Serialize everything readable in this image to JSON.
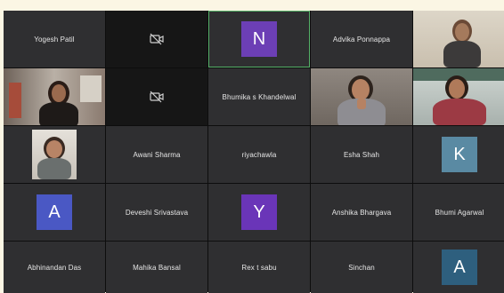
{
  "participants": [
    {
      "name": "Yogesh Patil"
    },
    {
      "name": ""
    },
    {
      "name": "",
      "initial": "N",
      "color": "#6c3fb5"
    },
    {
      "name": "Advika Ponnappa"
    },
    {
      "name": ""
    },
    {
      "name": ""
    },
    {
      "name": ""
    },
    {
      "name": "Bhumika s Khandelwal"
    },
    {
      "name": ""
    },
    {
      "name": ""
    },
    {
      "name": ""
    },
    {
      "name": "Awani Sharma"
    },
    {
      "name": "riyachawla"
    },
    {
      "name": "Esha Shah"
    },
    {
      "name": "",
      "initial": "K",
      "color": "#5a8aa3"
    },
    {
      "name": "",
      "initial": "A",
      "color": "#4a58c4"
    },
    {
      "name": "Deveshi Srivastava"
    },
    {
      "name": "",
      "initial": "Y",
      "color": "#6a35b8"
    },
    {
      "name": "Anshika Bhargava"
    },
    {
      "name": "Bhumi Agarwal"
    },
    {
      "name": "Abhinandan Das"
    },
    {
      "name": "Mahika Bansal"
    },
    {
      "name": "Rex t sabu"
    },
    {
      "name": "Sinchan"
    },
    {
      "name": "",
      "initial": "A",
      "color": "#2e5f7e"
    }
  ],
  "icons": {
    "camera_off": "camera-off-icon"
  }
}
